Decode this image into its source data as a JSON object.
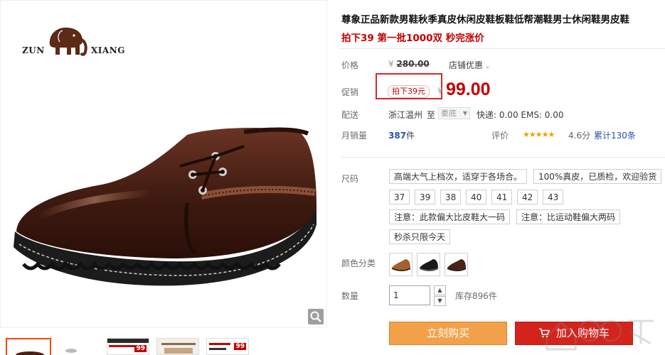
{
  "brand": {
    "left": "ZUN",
    "right": "XIANG"
  },
  "product": {
    "title": "尊象正品新款男鞋秋季真皮休闲皮鞋板鞋低帮潮鞋男士休闲鞋男皮鞋",
    "subtitle": "拍下39 第一批1000双 秒完涨价"
  },
  "price": {
    "label": "价格",
    "currency": "¥",
    "original": "280.00",
    "store_discount": "店铺优惠",
    "promo_label": "促销",
    "promo_tag": "拍下39元",
    "promo_price": "99.00"
  },
  "shipping": {
    "label": "配送",
    "from": "浙江温州",
    "to_word": "至",
    "destination": "娄底",
    "express": "快递: 0.00 EMS: 0.00"
  },
  "sales": {
    "label": "月销量",
    "count": "387",
    "unit": "件",
    "rating_label": "评价",
    "stars": "★★★★★",
    "score": "4.6分",
    "reviews": "累计130条"
  },
  "size": {
    "label": "尺码",
    "notes_top": [
      "高端大气上档次，适穿于各场合。",
      "100%真皮，已质检，欢迎验货"
    ],
    "options": [
      "37",
      "39",
      "38",
      "40",
      "41",
      "42",
      "43"
    ],
    "notes_bottom": [
      "注意：此款偏大比皮鞋大一码",
      "注意：比运动鞋偏大两码"
    ],
    "note_last": "秒杀只限今天"
  },
  "color": {
    "label": "颜色分类",
    "swatches": [
      "tan-shoe",
      "black-shoe",
      "brown-shoe"
    ]
  },
  "quantity": {
    "label": "数量",
    "value": "1",
    "stock": "库存896件"
  },
  "actions": {
    "buy_now": "立刻购买",
    "add_to_cart": "加入购物车"
  },
  "thumbs": {
    "t3_badge": "99",
    "t5_badge": "99"
  },
  "colors": {
    "accent_red": "#c40000",
    "buy_orange": "#f2a14a",
    "cart_red": "#d4231b"
  }
}
